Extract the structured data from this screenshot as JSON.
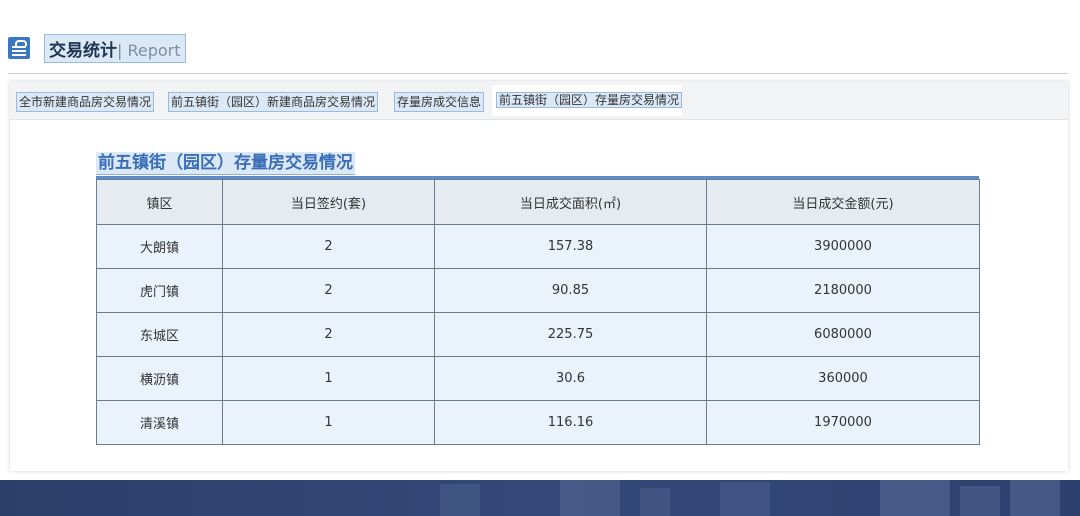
{
  "header": {
    "title": "交易统计",
    "title_en": "| Report"
  },
  "tabs": [
    {
      "label": "全市新建商品房交易情况",
      "active": false
    },
    {
      "label": "前五镇街（园区）新建商品房交易情况",
      "active": false
    },
    {
      "label": "存量房成交信息",
      "active": false
    },
    {
      "label": "前五镇街（园区）存量房交易情况",
      "active": true
    }
  ],
  "table": {
    "title": "前五镇街（园区）存量房交易情况",
    "columns": [
      "镇区",
      "当日签约(套)",
      "当日成交面积(㎡)",
      "当日成交金额(元)"
    ],
    "rows": [
      [
        "大朗镇",
        "2",
        "157.38",
        "3900000"
      ],
      [
        "虎门镇",
        "2",
        "90.85",
        "2180000"
      ],
      [
        "东城区",
        "2",
        "225.75",
        "6080000"
      ],
      [
        "横沥镇",
        "1",
        "30.6",
        "360000"
      ],
      [
        "清溪镇",
        "1",
        "116.16",
        "1970000"
      ]
    ]
  },
  "colors": {
    "accent": "#3a78c4",
    "tab_bg": "#dbe8f6",
    "footer_bg": "#2f4470"
  }
}
